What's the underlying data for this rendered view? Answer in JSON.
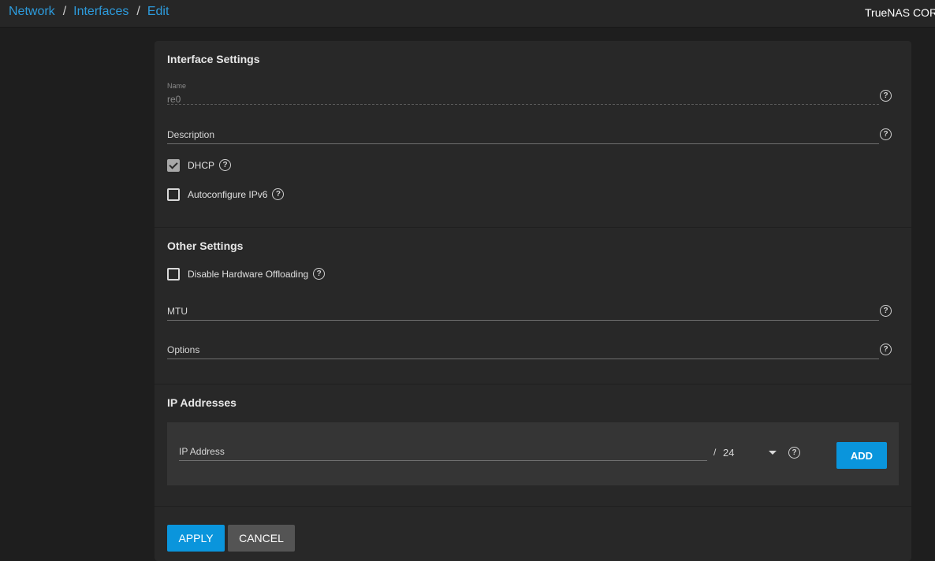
{
  "breadcrumb": {
    "items": [
      "Network",
      "Interfaces",
      "Edit"
    ],
    "separator": "/"
  },
  "brand": "TrueNAS CORE",
  "interface_settings": {
    "title": "Interface Settings",
    "name_label": "Name",
    "name_value": "re0",
    "description_label": "Description",
    "dhcp_label": "DHCP",
    "dhcp_checked": true,
    "autoconfig_label": "Autoconfigure IPv6",
    "autoconfig_checked": false
  },
  "other_settings": {
    "title": "Other Settings",
    "offload_label": "Disable Hardware Offloading",
    "offload_checked": false,
    "mtu_label": "MTU",
    "options_label": "Options"
  },
  "ip_addresses": {
    "title": "IP Addresses",
    "ip_label": "IP Address",
    "slash": "/",
    "netmask": "24",
    "add_label": "ADD"
  },
  "actions": {
    "apply_label": "APPLY",
    "cancel_label": "CANCEL"
  },
  "icons": {
    "help": "help-circle-icon",
    "checkmark": "check-icon",
    "dropdown": "caret-down-icon"
  },
  "help_glyph": "?",
  "colors": {
    "accent": "#0a95dc",
    "link": "#2d9bdc",
    "background": "#1e1e1e",
    "card": "#282828"
  }
}
